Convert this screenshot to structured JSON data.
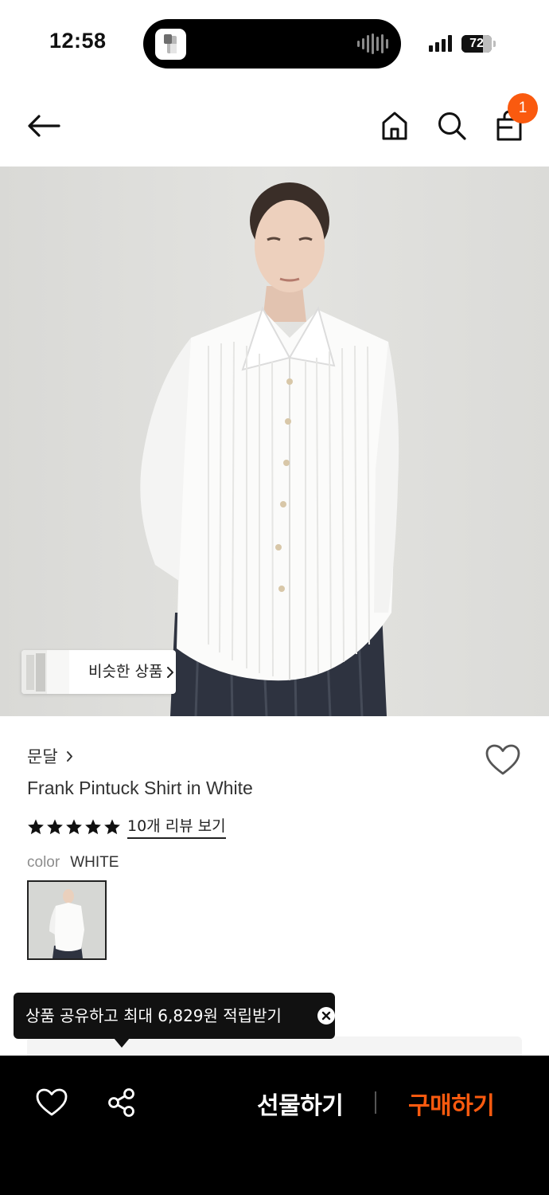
{
  "status_bar": {
    "time": "12:58",
    "battery": "72",
    "battery_level": 0.72
  },
  "nav": {
    "cart_count": "1"
  },
  "hero": {
    "similar_label": "비슷한 상품"
  },
  "product": {
    "brand": "문달",
    "title": "Frank Pintuck Shirt in White",
    "rating_stars": 5,
    "review_link": "10개 리뷰 보기",
    "color_label": "color",
    "color_value": "WHITE"
  },
  "tooltip": {
    "text": "상품 공유하고 최대 6,829원 적립받기"
  },
  "bottom_bar": {
    "gift_label": "선물하기",
    "buy_label": "구매하기"
  },
  "colors": {
    "accent": "#fa5a0f",
    "tooltip_bg": "#111111",
    "bottom_bar_bg": "#000000"
  },
  "icons": [
    "arrow-left-icon",
    "home-icon",
    "search-icon",
    "shopping-bag-icon",
    "heart-icon",
    "share-icon",
    "close-icon",
    "chevron-right-icon",
    "star-icon",
    "soundwave-icon",
    "cellular-signal-icon",
    "battery-icon"
  ]
}
